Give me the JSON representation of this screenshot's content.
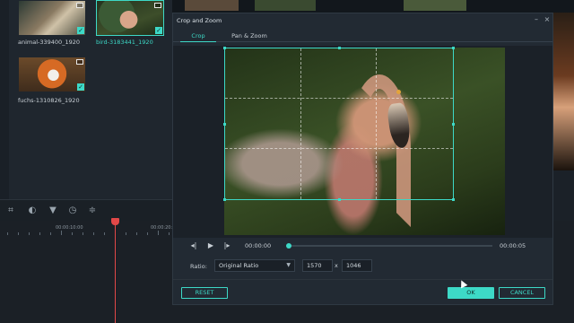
{
  "library": {
    "items": [
      {
        "label": "animal-339400_1920",
        "selected": false,
        "checked": true
      },
      {
        "label": "bird-3183441_1920",
        "selected": true,
        "checked": true
      },
      {
        "label": "fuchs-1310826_1920",
        "selected": false,
        "checked": true
      }
    ]
  },
  "toolbar": {
    "icons": [
      "crop-icon",
      "color-icon",
      "green-screen-icon",
      "speed-icon",
      "audio-mixer-icon"
    ]
  },
  "timeline": {
    "ruler_labels": [
      "00:00:10:00",
      "00:00:20:0"
    ]
  },
  "dialog": {
    "title": "Crop and Zoom",
    "tabs": [
      {
        "label": "Crop",
        "active": true
      },
      {
        "label": "Pan & Zoom",
        "active": false
      }
    ],
    "player": {
      "current_time": "00:00:00",
      "duration": "00:00:05",
      "progress": 0
    },
    "ratio": {
      "label": "Ratio:",
      "selected": "Original Ratio",
      "width": "1570",
      "separator": "x",
      "height": "1046"
    },
    "buttons": {
      "reset": "RESET",
      "ok": "OK",
      "cancel": "CANCEL"
    }
  },
  "colors": {
    "accent": "#3dd9c7",
    "playhead": "#e24848",
    "dialog_bg": "#222a33"
  }
}
